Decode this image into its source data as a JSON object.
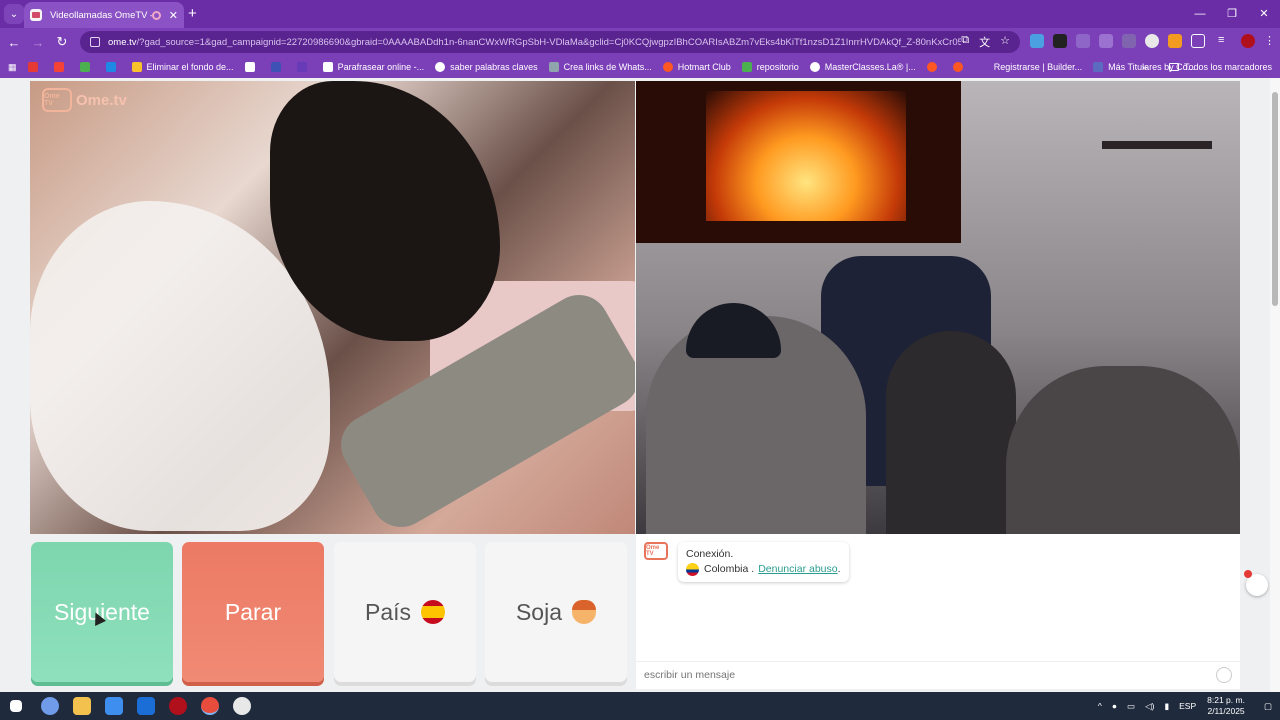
{
  "browser": {
    "tab_title": "Videollamadas OmeTV — A",
    "url_host": "ome.tv",
    "url_rest": "/?gad_source=1&gad_campaignid=22720986690&gbraid=0AAAABADdh1n-6nanCWxWRGpSbH-VDlaMa&gclid=Cj0KCQjwgpzIBhCOARIsABZm7vEks4bKiTf1nzsD1Z1InrrHVDAkQf_Z-80nKxCr05Gfy...",
    "bookmarks": [
      "Eliminar el fondo de...",
      "Parafrasear online -...",
      "saber palabras claves",
      "Crea links de Whats...",
      "Hotmart Club",
      "repositorio",
      "MasterClasses.La® |...",
      "Registrarse | Builder...",
      "Más Titulares by Co..."
    ],
    "all_bookmarks": "Todos los marcadores"
  },
  "page": {
    "logo_text": "Ome.tv",
    "logo_badge": "Ome TV",
    "buttons": {
      "next": "Siguiente",
      "stop": "Parar",
      "country": "País",
      "gender": "Soja"
    },
    "chat": {
      "connection": "Conexión.",
      "country": "Colombia .",
      "report": "Denunciar abuso",
      "report_suffix": ".",
      "input_placeholder": "escribir un mensaje"
    }
  },
  "taskbar": {
    "language": "ESP",
    "time": "8:21 p. m.",
    "date": "2/11/2025"
  }
}
